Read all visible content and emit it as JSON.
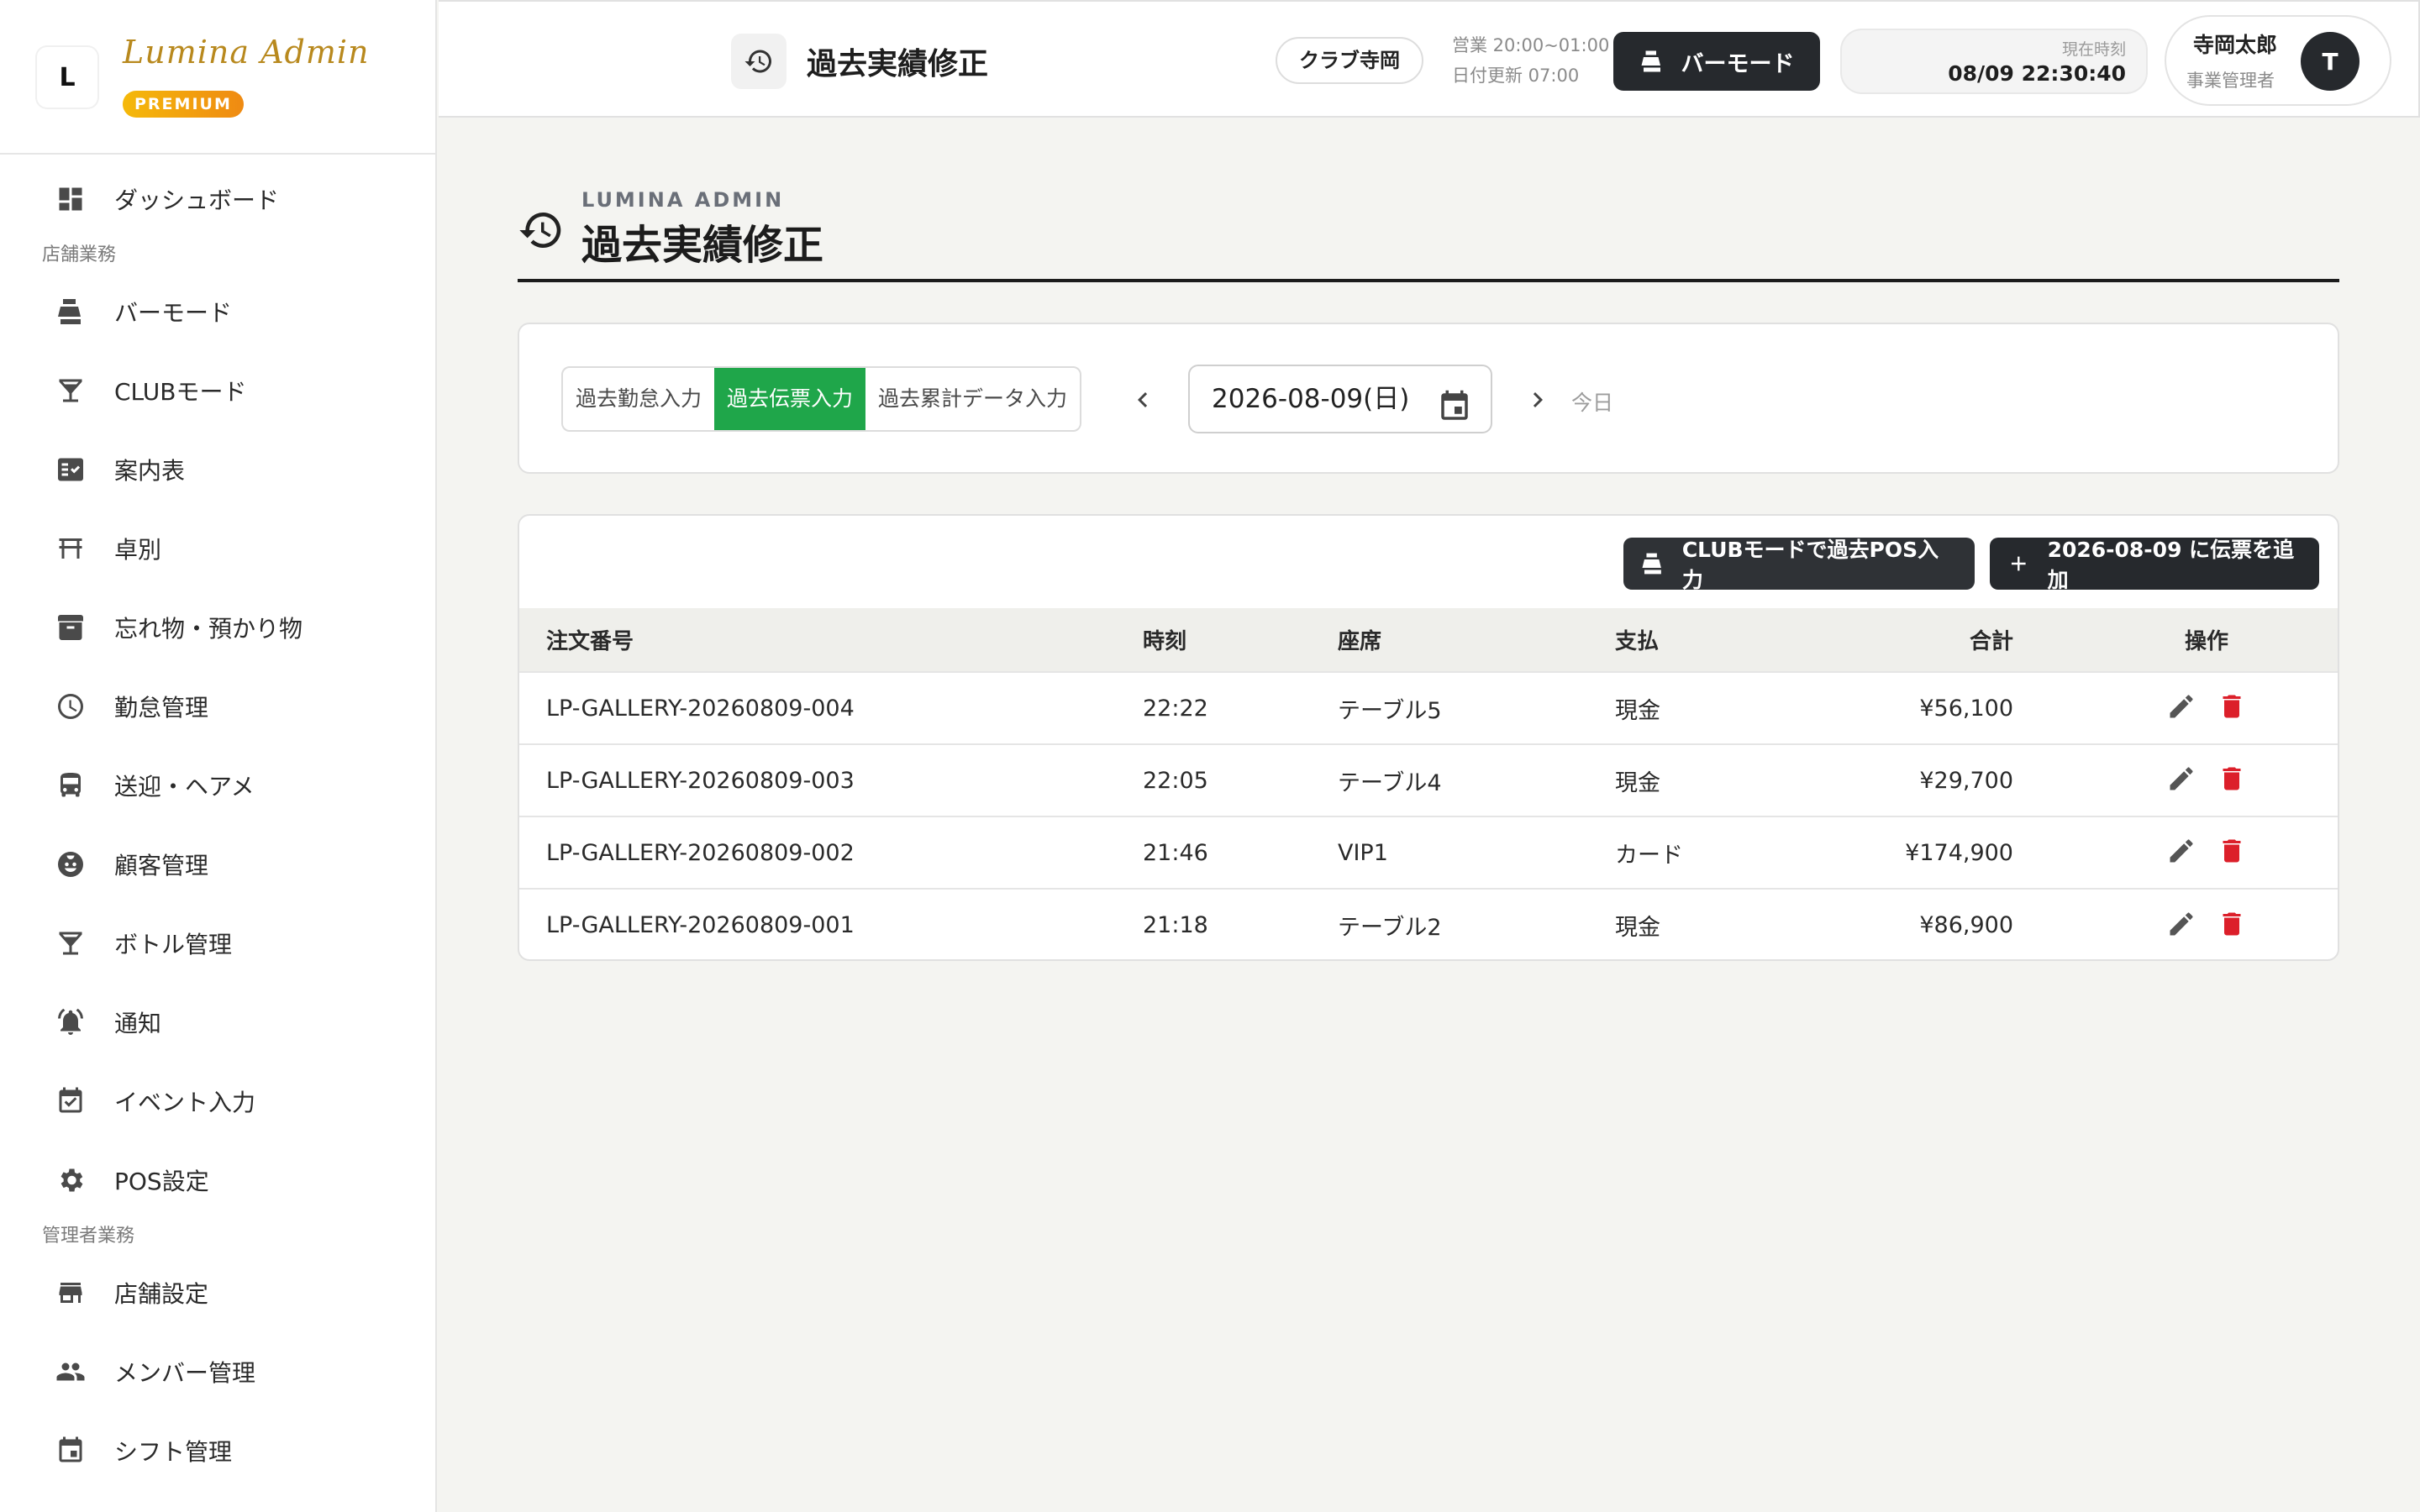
{
  "brand": {
    "logo_letter": "L",
    "name": "Lumina Admin",
    "badge": "PREMIUM"
  },
  "sidebar": {
    "items": [
      {
        "label": "ダッシュボード",
        "icon": "dashboard-icon"
      },
      {
        "section": "店舗業務"
      },
      {
        "label": "バーモード",
        "icon": "cash-register-icon"
      },
      {
        "label": "CLUBモード",
        "icon": "cocktail-icon"
      },
      {
        "label": "案内表",
        "icon": "checklist-icon"
      },
      {
        "label": "卓別",
        "icon": "table-icon"
      },
      {
        "label": "忘れ物・預かり物",
        "icon": "archive-icon"
      },
      {
        "label": "勤怠管理",
        "icon": "clock-icon"
      },
      {
        "label": "送迎・ヘアメ",
        "icon": "bus-icon"
      },
      {
        "label": "顧客管理",
        "icon": "face-icon"
      },
      {
        "label": "ボトル管理",
        "icon": "bottle-icon"
      },
      {
        "label": "通知",
        "icon": "bell-icon"
      },
      {
        "label": "イベント入力",
        "icon": "calendar-check-icon"
      },
      {
        "label": "POS設定",
        "icon": "gear-icon"
      },
      {
        "section": "管理者業務"
      },
      {
        "label": "店舗設定",
        "icon": "store-icon"
      },
      {
        "label": "メンバー管理",
        "icon": "people-icon"
      },
      {
        "label": "シフト管理",
        "icon": "calendar-icon"
      }
    ]
  },
  "topbar": {
    "title": "過去実績修正",
    "store": "クラブ寺岡",
    "hours": "営業 20:00~01:00",
    "day_change": "日付更新 07:00",
    "mode_button": "バーモード",
    "clock_label": "現在時刻",
    "clock_time": "08/09 22:30:40",
    "user_name": "寺岡太郎",
    "user_role": "事業管理者",
    "avatar_initial": "T"
  },
  "page": {
    "kicker": "LUMINA ADMIN",
    "title": "過去実績修正"
  },
  "filters": {
    "tabs": [
      "過去勤怠入力",
      "過去伝票入力",
      "過去累計データ入力"
    ],
    "active_tab": "過去伝票入力",
    "date": "2026-08-09(日)",
    "today": "今日"
  },
  "actions": {
    "pos_button": "CLUBモードで過去POS入力",
    "add_button": "2026-08-09 に伝票を追加"
  },
  "table": {
    "columns": [
      "注文番号",
      "時刻",
      "座席",
      "支払",
      "合計",
      "操作"
    ],
    "rows": [
      {
        "order": "LP-GALLERY-20260809-004",
        "time": "22:22",
        "seat": "テーブル5",
        "payment": "現金",
        "total": "¥56,100"
      },
      {
        "order": "LP-GALLERY-20260809-003",
        "time": "22:05",
        "seat": "テーブル4",
        "payment": "現金",
        "total": "¥29,700"
      },
      {
        "order": "LP-GALLERY-20260809-002",
        "time": "21:46",
        "seat": "VIP1",
        "payment": "カード",
        "total": "¥174,900"
      },
      {
        "order": "LP-GALLERY-20260809-001",
        "time": "21:18",
        "seat": "テーブル2",
        "payment": "現金",
        "total": "¥86,900"
      }
    ]
  },
  "colors": {
    "accent_green": "#1fa64a",
    "dark_button": "#26292d",
    "delete_red": "#dc1f2a",
    "brand_gold": "#b8891e"
  }
}
